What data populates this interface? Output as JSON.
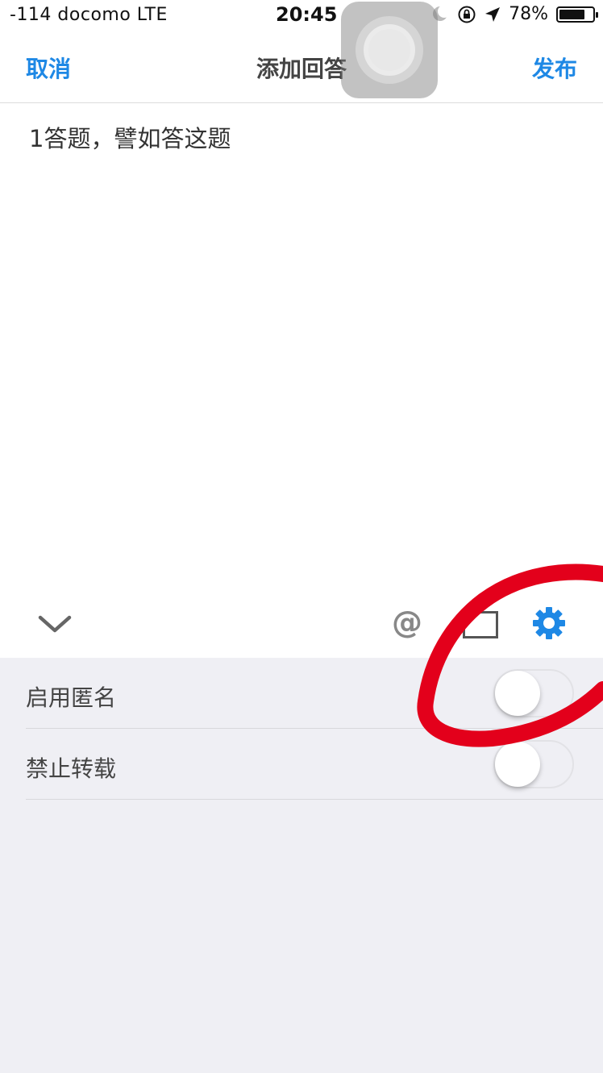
{
  "status_bar": {
    "carrier": "-114 docomo  LTE",
    "time": "20:45",
    "battery_percent": "78%",
    "battery_level": 0.78,
    "icons": [
      "moon-icon",
      "rotation-lock-icon",
      "location-arrow-icon",
      "battery-icon"
    ]
  },
  "nav": {
    "cancel_label": "取消",
    "title": "添加回答",
    "publish_label": "发布"
  },
  "editor": {
    "content": "1答题，譬如答这题"
  },
  "toolbar": {
    "at_symbol": "@",
    "icons": [
      "chevron-down-icon",
      "at-icon",
      "image-icon",
      "gear-icon"
    ]
  },
  "settings": {
    "rows": [
      {
        "label": "启用匿名",
        "enabled": false
      },
      {
        "label": "禁止转载",
        "enabled": false
      }
    ]
  },
  "colors": {
    "accent": "#1e88e5",
    "panel_bg": "#efeff4",
    "annotation": "#e3001b"
  }
}
